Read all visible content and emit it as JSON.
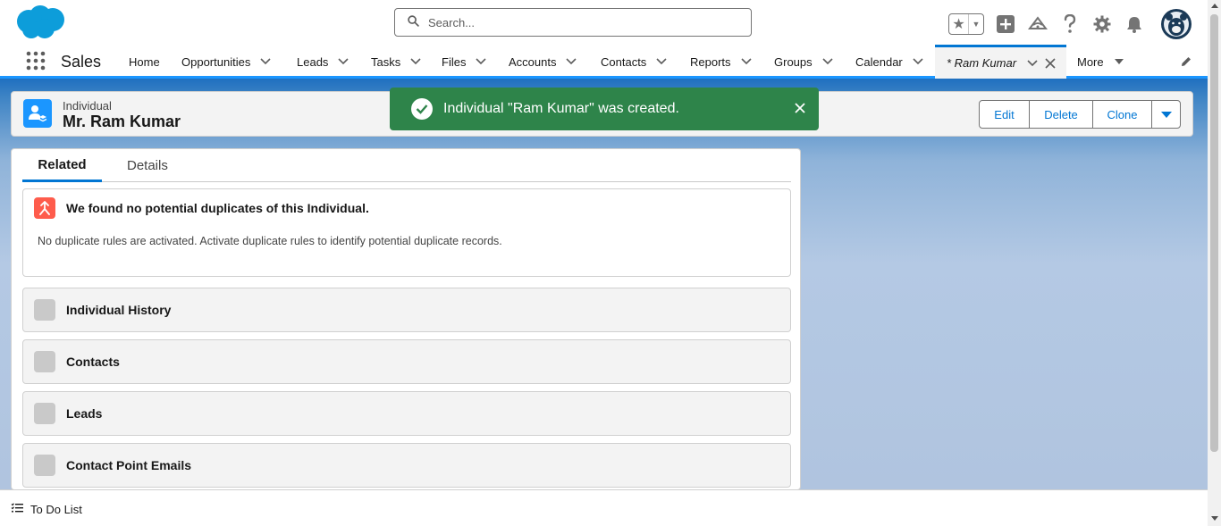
{
  "header": {
    "search_placeholder": "Search...",
    "icons": [
      "favorites-star-icon",
      "add-icon",
      "trailhead-icon",
      "help-icon",
      "setup-gear-icon",
      "notifications-bell-icon",
      "user-avatar"
    ]
  },
  "nav": {
    "app_name": "Sales",
    "items": [
      {
        "label": "Home"
      },
      {
        "label": "Opportunities"
      },
      {
        "label": "Leads"
      },
      {
        "label": "Tasks"
      },
      {
        "label": "Files"
      },
      {
        "label": "Accounts"
      },
      {
        "label": "Contacts"
      },
      {
        "label": "Reports"
      },
      {
        "label": "Groups"
      },
      {
        "label": "Calendar"
      }
    ],
    "active_tab": "* Ram Kumar",
    "more_label": "More"
  },
  "record": {
    "object_type": "Individual",
    "name": "Mr. Ram Kumar",
    "actions": {
      "edit": "Edit",
      "delete": "Delete",
      "clone": "Clone"
    }
  },
  "toast": {
    "message": "Individual \"Ram Kumar\" was created.",
    "color": "#2e844a"
  },
  "tabs": {
    "related": "Related",
    "details": "Details",
    "selected": "Related"
  },
  "duplicates": {
    "title": "We found no potential duplicates of this Individual.",
    "text": "No duplicate rules are activated. Activate duplicate rules to identify potential duplicate records."
  },
  "related_lists": [
    {
      "label": "Individual History"
    },
    {
      "label": "Contacts"
    },
    {
      "label": "Leads"
    },
    {
      "label": "Contact Point Emails"
    }
  ],
  "utility_bar": {
    "todo_label": "To Do List"
  },
  "colors": {
    "brand": "#0176d3",
    "record_icon": "#1b96ff",
    "duplicate_icon": "#fe5c4c",
    "success": "#2e844a"
  }
}
